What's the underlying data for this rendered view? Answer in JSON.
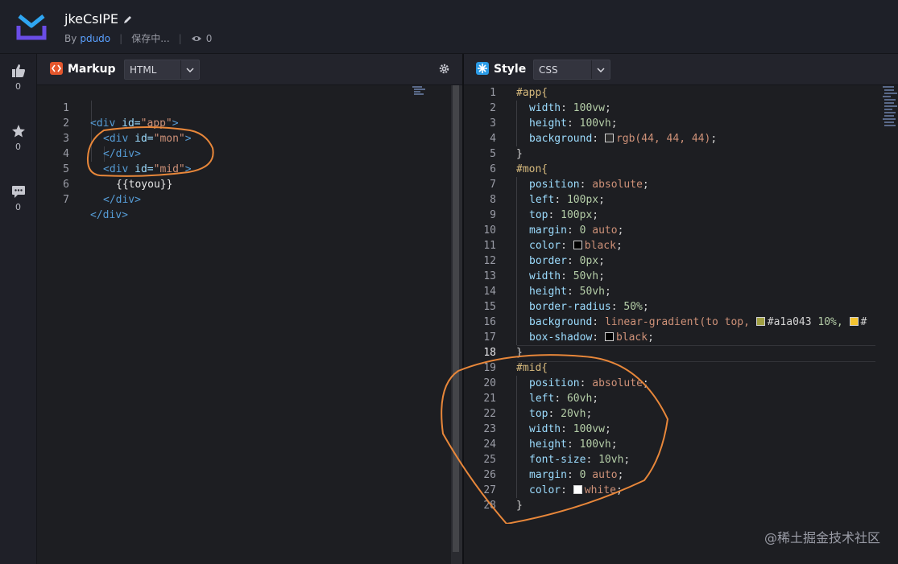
{
  "header": {
    "title": "jkeCsIPE",
    "by_label": "By",
    "author": "pdudo",
    "save_status": "保存中...",
    "views": "0"
  },
  "rail": {
    "like_count": "0",
    "star_count": "0",
    "comment_count": "0"
  },
  "markup_panel": {
    "name": "Markup",
    "language": "HTML",
    "lines": [
      {
        "n": "1"
      },
      {
        "n": "2"
      },
      {
        "n": "3"
      },
      {
        "n": "4"
      },
      {
        "n": "5"
      },
      {
        "n": "6"
      },
      {
        "n": "7"
      }
    ],
    "code": {
      "l1": {
        "open": "<div",
        "attr": " id=",
        "val": "\"app\"",
        "close": ">"
      },
      "l2": {
        "open": "<div",
        "attr": " id=",
        "val": "\"mon\"",
        "close": ">"
      },
      "l3": {
        "tag": "</div>"
      },
      "l4": {
        "open": "<div",
        "attr": " id=",
        "val": "\"mid\"",
        "close": ">"
      },
      "l5": {
        "text": "{{toyou}}"
      },
      "l6": {
        "tag": "</div>"
      },
      "l7": {
        "tag": "</div>"
      }
    }
  },
  "style_panel": {
    "name": "Style",
    "language": "CSS",
    "code": {
      "l1": "#app{",
      "l2_p": "width",
      "l2_v": "100vw",
      "l3_p": "height",
      "l3_v": "100vh",
      "l4_p": "background",
      "l4_v": "rgb(44, 44, 44)",
      "l5": "}",
      "l6": "#mon{",
      "l7_p": "position",
      "l7_v": "absolute",
      "l8_p": "left",
      "l8_v": "100px",
      "l9_p": "top",
      "l9_v": "100px",
      "l10_p": "margin",
      "l10_v1": "0",
      "l10_v2": "auto",
      "l11_p": "color",
      "l11_v": "black",
      "l12_p": "border",
      "l12_v": "0px",
      "l13_p": "width",
      "l13_v": "50vh",
      "l14_p": "height",
      "l14_v": "50vh",
      "l15_p": "border-radius",
      "l15_v": "50%",
      "l16_p": "background",
      "l16_fn": "linear-gradient(to top,",
      "l16_c1": "#a1a043",
      "l16_pct": "10%,",
      "l16_c2": "#",
      "l17_p": "box-shadow",
      "l17_v": "black",
      "l18": "}",
      "l19": "#mid{",
      "l20_p": "position",
      "l20_v": "absolute",
      "l21_p": "left",
      "l21_v": "60vh",
      "l22_p": "top",
      "l22_v": "20vh",
      "l23_p": "width",
      "l23_v": "100vw",
      "l24_p": "height",
      "l24_v": "100vh",
      "l25_p": "font-size",
      "l25_v": "10vh",
      "l26_p": "margin",
      "l26_v1": "0",
      "l26_v2": "auto",
      "l27_p": "color",
      "l27_v": "white",
      "l28": "}"
    }
  },
  "colors": {
    "swatch_bg": "#2c2c2c",
    "swatch_black": "#000000",
    "swatch_gradient1": "#a1a043",
    "swatch_gradient2": "#f4c430",
    "swatch_white": "#ffffff",
    "annotation": "#e8873a"
  },
  "watermark": "@稀土掘金技术社区"
}
